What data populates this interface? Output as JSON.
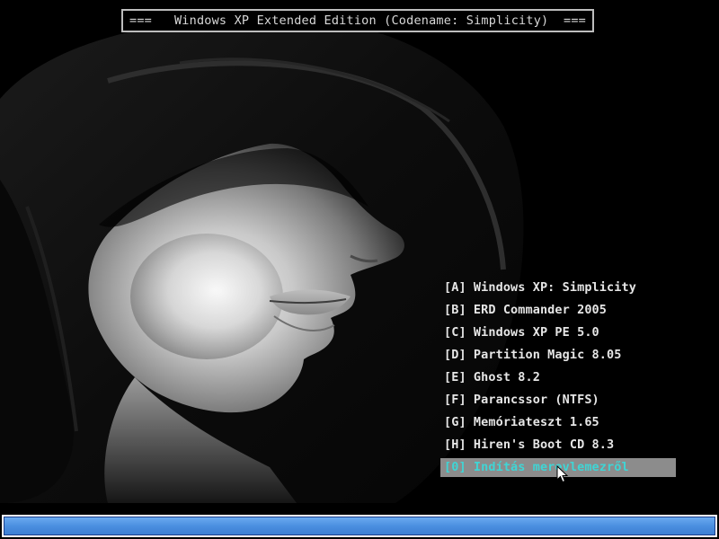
{
  "boot_screen": {
    "title": "===   Windows XP Extended Edition (Codename: Simplicity)  ===",
    "wallpaper": "hooded-woman-profile-black-and-white",
    "menu": {
      "items": [
        {
          "label": "[A] Windows XP: Simplicity",
          "selected": false
        },
        {
          "label": "[B] ERD Commander 2005",
          "selected": false
        },
        {
          "label": "[C] Windows XP PE 5.0",
          "selected": false
        },
        {
          "label": "[D] Partition Magic 8.05",
          "selected": false
        },
        {
          "label": "[E] Ghost 8.2",
          "selected": false
        },
        {
          "label": "[F] Parancssor (NTFS)",
          "selected": false
        },
        {
          "label": "[G] Memóriateszt 1.65",
          "selected": false
        },
        {
          "label": "[H] Hiren's Boot CD 8.3",
          "selected": false
        },
        {
          "label": "[0] Indítás merevlemezről",
          "selected": true
        }
      ]
    },
    "cursor_icon": "arrow-pointer-icon",
    "progress": {
      "fraction": 1.0
    },
    "colors": {
      "menu_text": "#e6e6e6",
      "selected_bg": "#8c8c8c",
      "selected_text": "#3fd5d5",
      "progress_fill": "#4b8fe0",
      "title_border": "#bdbdbd"
    }
  }
}
